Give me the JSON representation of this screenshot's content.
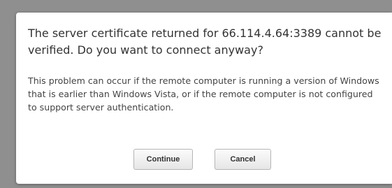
{
  "dialog": {
    "heading": "The server certificate returned for 66.114.4.64:3389 cannot be verified. Do you want to connect anyway?",
    "message": "This problem can occur if the remote computer is running a version of Windows that is earlier than Windows Vista, or if the remote computer is not configured to support server authentication.",
    "buttons": {
      "continue_label": "Continue",
      "cancel_label": "Cancel"
    }
  }
}
